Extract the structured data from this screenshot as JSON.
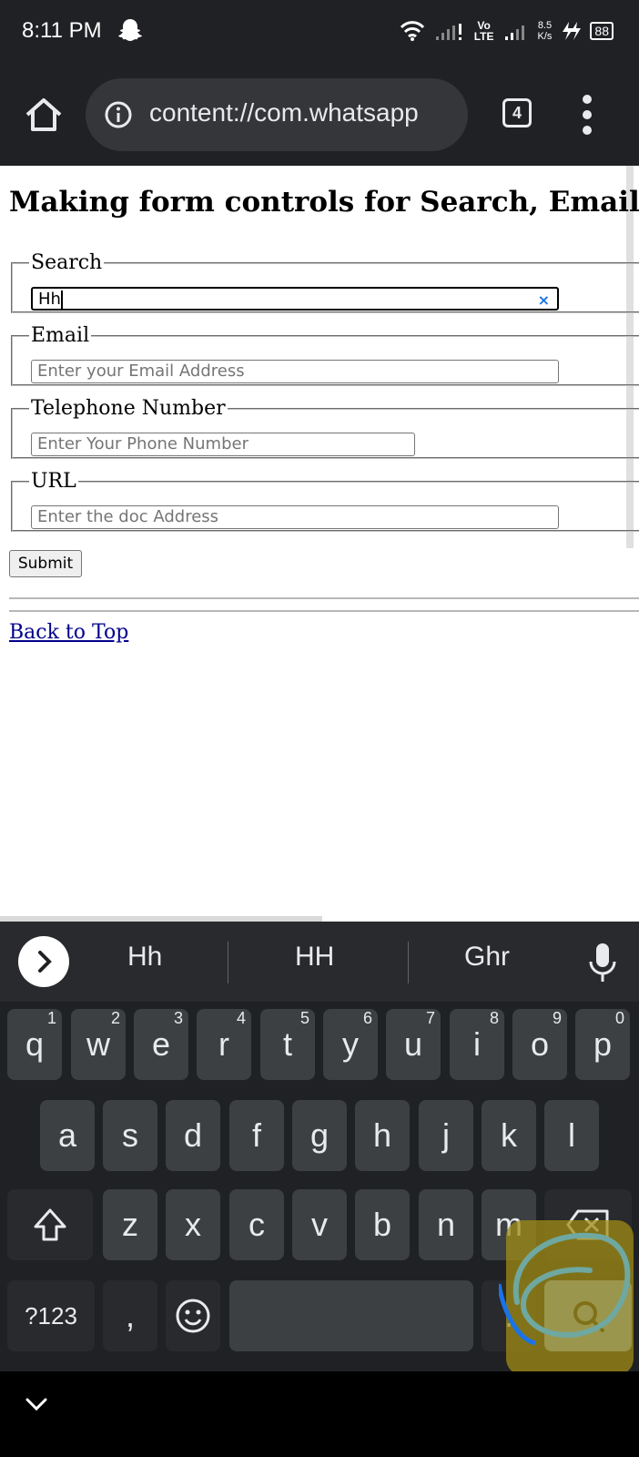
{
  "status_bar": {
    "time": "8:11 PM",
    "volte_top": "Vo",
    "volte_bottom": "LTE",
    "speed_value": "8.5",
    "speed_unit": "K/s",
    "battery": "88"
  },
  "browser": {
    "url": "content://com.whatsapp",
    "tab_count": "4"
  },
  "page": {
    "title": "Making form controls for Search, Email, Telephone and URL",
    "fields": [
      {
        "legend": "Search",
        "value": "Hh",
        "placeholder": ""
      },
      {
        "legend": "Email",
        "value": "",
        "placeholder": "Enter your Email Address"
      },
      {
        "legend": "Telephone Number",
        "value": "",
        "placeholder": "Enter Your Phone Number"
      },
      {
        "legend": "URL",
        "value": "",
        "placeholder": "Enter the doc Address"
      }
    ],
    "clear_symbol": "×",
    "submit_label": "Submit",
    "back_link": "Back to Top"
  },
  "keyboard": {
    "suggestions": [
      "Hh",
      "HH",
      "Ghr"
    ],
    "row1": [
      {
        "key": "q",
        "num": "1"
      },
      {
        "key": "w",
        "num": "2"
      },
      {
        "key": "e",
        "num": "3"
      },
      {
        "key": "r",
        "num": "4"
      },
      {
        "key": "t",
        "num": "5"
      },
      {
        "key": "y",
        "num": "6"
      },
      {
        "key": "u",
        "num": "7"
      },
      {
        "key": "i",
        "num": "8"
      },
      {
        "key": "o",
        "num": "9"
      },
      {
        "key": "p",
        "num": "0"
      }
    ],
    "row2": [
      "a",
      "s",
      "d",
      "f",
      "g",
      "h",
      "j",
      "k",
      "l"
    ],
    "row3": [
      "z",
      "x",
      "c",
      "v",
      "b",
      "n",
      "m"
    ],
    "symbols_label": "?123",
    "comma_label": ",",
    "period_label": "."
  },
  "colors": {
    "chrome_dark": "#202124",
    "keyboard_key": "#3c4043",
    "link": "#00008b",
    "highlight": "#a08c14"
  }
}
